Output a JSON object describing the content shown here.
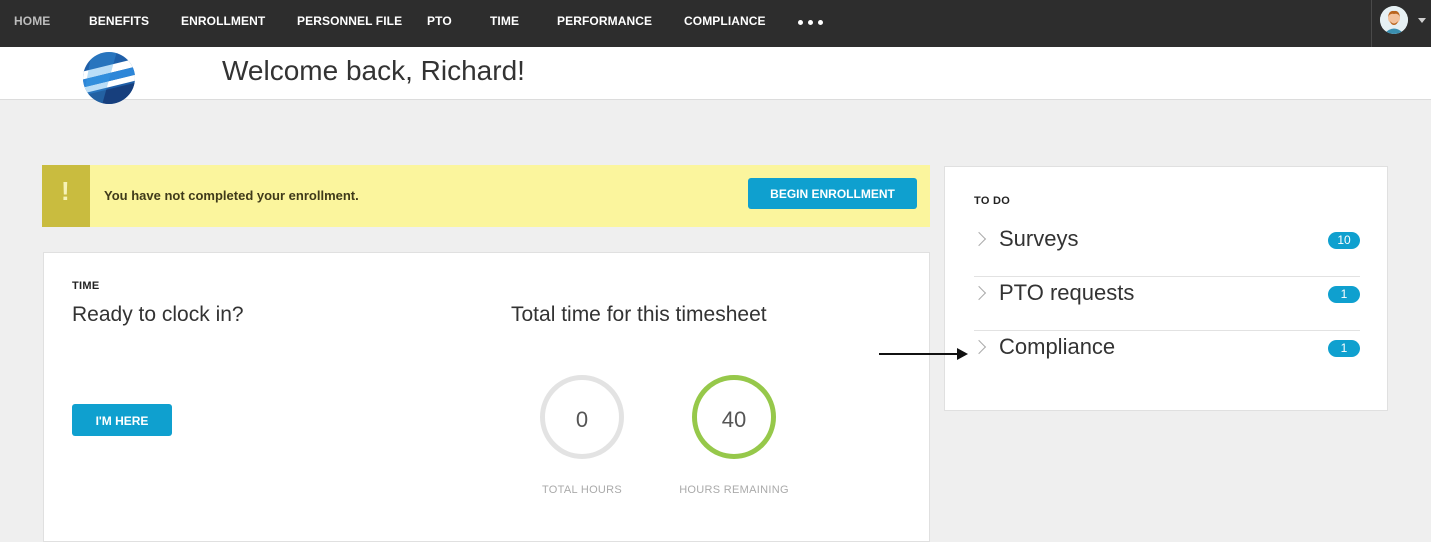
{
  "nav": {
    "items": [
      {
        "label": "HOME",
        "active": true
      },
      {
        "label": "BENEFITS"
      },
      {
        "label": "ENROLLMENT"
      },
      {
        "label": "PERSONNEL FILE"
      },
      {
        "label": "PTO"
      },
      {
        "label": "TIME"
      },
      {
        "label": "PERFORMANCE"
      },
      {
        "label": "COMPLIANCE"
      }
    ]
  },
  "header": {
    "welcome": "Welcome back, Richard!"
  },
  "alert": {
    "message": "You have not completed your enrollment.",
    "icon": "!",
    "button_label": "BEGIN ENROLLMENT"
  },
  "time_card": {
    "label": "TIME",
    "prompt": "Ready to clock in?",
    "button_label": "I'M HERE",
    "timesheet_title": "Total time for this timesheet",
    "total_hours": "0",
    "total_caption": "TOTAL HOURS",
    "hours_remaining": "40",
    "remaining_caption": "HOURS REMAINING"
  },
  "todo": {
    "label": "TO DO",
    "items": [
      {
        "label": "Surveys",
        "count": "10"
      },
      {
        "label": "PTO requests",
        "count": "1"
      },
      {
        "label": "Compliance",
        "count": "1"
      }
    ]
  },
  "colors": {
    "nav_bg": "#2d2d2d",
    "accent": "#0fa0cf",
    "alert_bg": "#fbf59d",
    "alert_icon_bg": "#c9bc3f",
    "ring_remaining": "#96c84a"
  }
}
